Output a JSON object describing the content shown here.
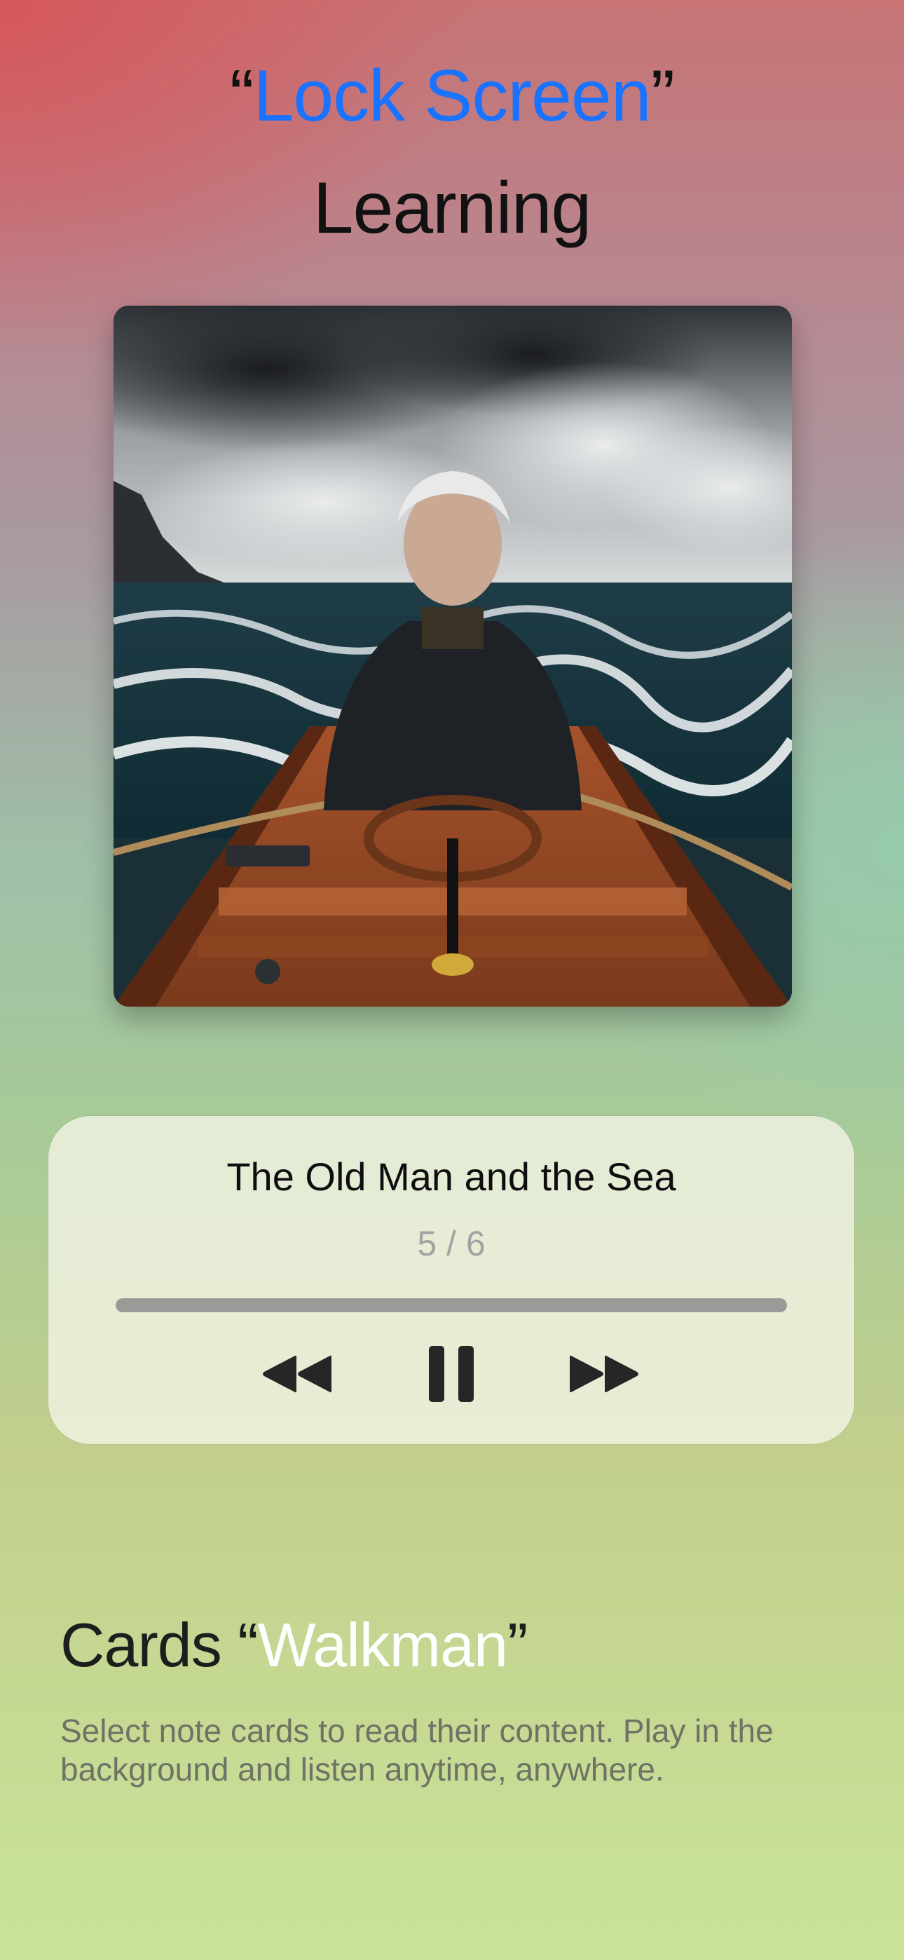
{
  "headline": {
    "open_quote": "“",
    "accent": "Lock Screen",
    "close_quote": "”",
    "line2": "Learning",
    "accent_color": "#1a73ff"
  },
  "artwork": {
    "description_icon": "book-cover-artwork"
  },
  "player": {
    "title": "The Old Man and the Sea",
    "counter": "5 / 6",
    "progress": 1.0,
    "controls": {
      "rewind_icon": "rewind-icon",
      "pause_icon": "pause-icon",
      "forward_icon": "fast-forward-icon"
    }
  },
  "feature": {
    "title_prefix": "Cards ",
    "title_open_quote": "“",
    "title_accent": "Walkman",
    "title_close_quote": "”",
    "description": "Select note cards to read their content. Play in the background and listen anytime, anywhere."
  }
}
